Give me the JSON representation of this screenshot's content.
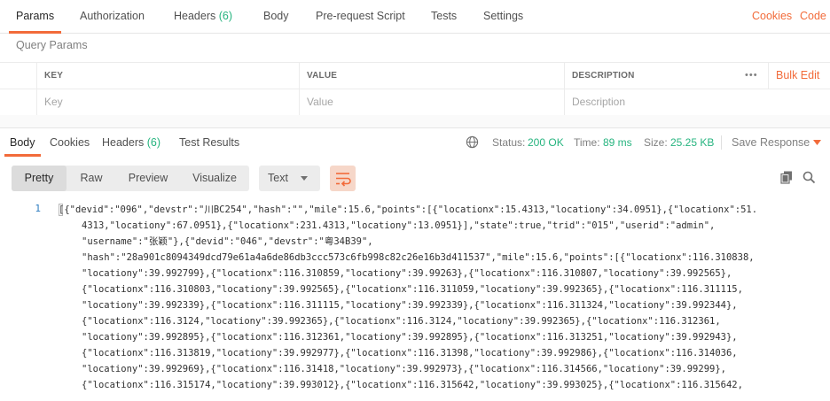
{
  "request_tabs": {
    "params": "Params",
    "authorization": "Authorization",
    "headers": "Headers",
    "headers_count": "(6)",
    "body": "Body",
    "prerequest": "Pre-request Script",
    "tests": "Tests",
    "settings": "Settings",
    "cookies": "Cookies",
    "code": "Code"
  },
  "query_params": {
    "title": "Query Params",
    "headers": [
      "KEY",
      "VALUE",
      "DESCRIPTION"
    ],
    "more": "•••",
    "bulk_edit": "Bulk Edit",
    "placeholders": {
      "key": "Key",
      "value": "Value",
      "description": "Description"
    }
  },
  "response_tabs": {
    "body": "Body",
    "cookies": "Cookies",
    "headers": "Headers",
    "headers_count": "(6)",
    "test_results": "Test Results"
  },
  "status": {
    "status_label": "Status:",
    "status_value": "200 OK",
    "time_label": "Time:",
    "time_value": "89 ms",
    "size_label": "Size:",
    "size_value": "25.25 KB",
    "save_response": "Save Response"
  },
  "viewer": {
    "modes": [
      "Pretty",
      "Raw",
      "Preview",
      "Visualize"
    ],
    "active_mode": "Pretty",
    "format": "Text"
  },
  "code": {
    "line_number": "1",
    "lines": [
      "[{\"devid\":\"096\",\"devstr\":\"川BC254\",\"hash\":\"\",\"mile\":15.6,\"points\":[{\"locationx\":15.4313,\"locationy\":34.0951},{\"locationx\":51.",
      "4313,\"locationy\":67.0951},{\"locationx\":231.4313,\"locationy\":13.0951}],\"state\":true,\"trid\":\"015\",\"userid\":\"admin\",",
      "\"username\":\"张颖\"},{\"devid\":\"046\",\"devstr\":\"粤34B39\",",
      "\"hash\":\"28a901c8094349dcd79e61a4a6de86db3ccc573c6fb998c82c26e16b3d411537\",\"mile\":15.6,\"points\":[{\"locationx\":116.310838,",
      "\"locationy\":39.992799},{\"locationx\":116.310859,\"locationy\":39.99263},{\"locationx\":116.310807,\"locationy\":39.992565},",
      "{\"locationx\":116.310803,\"locationy\":39.992565},{\"locationx\":116.311059,\"locationy\":39.992365},{\"locationx\":116.311115,",
      "\"locationy\":39.992339},{\"locationx\":116.311115,\"locationy\":39.992339},{\"locationx\":116.311324,\"locationy\":39.992344},",
      "{\"locationx\":116.3124,\"locationy\":39.992365},{\"locationx\":116.3124,\"locationy\":39.992365},{\"locationx\":116.312361,",
      "\"locationy\":39.992895},{\"locationx\":116.312361,\"locationy\":39.992895},{\"locationx\":116.313251,\"locationy\":39.992943},",
      "{\"locationx\":116.313819,\"locationy\":39.992977},{\"locationx\":116.31398,\"locationy\":39.992986},{\"locationx\":116.314036,",
      "\"locationy\":39.992969},{\"locationx\":116.31418,\"locationy\":39.992973},{\"locationx\":116.314566,\"locationy\":39.99299},",
      "{\"locationx\":116.315174,\"locationy\":39.993012},{\"locationx\":116.315642,\"locationy\":39.993025},{\"locationx\":116.315642,"
    ]
  },
  "colors": {
    "accent": "#f26b3a",
    "success": "#26b47f",
    "line_number": "#2e7cc0"
  }
}
